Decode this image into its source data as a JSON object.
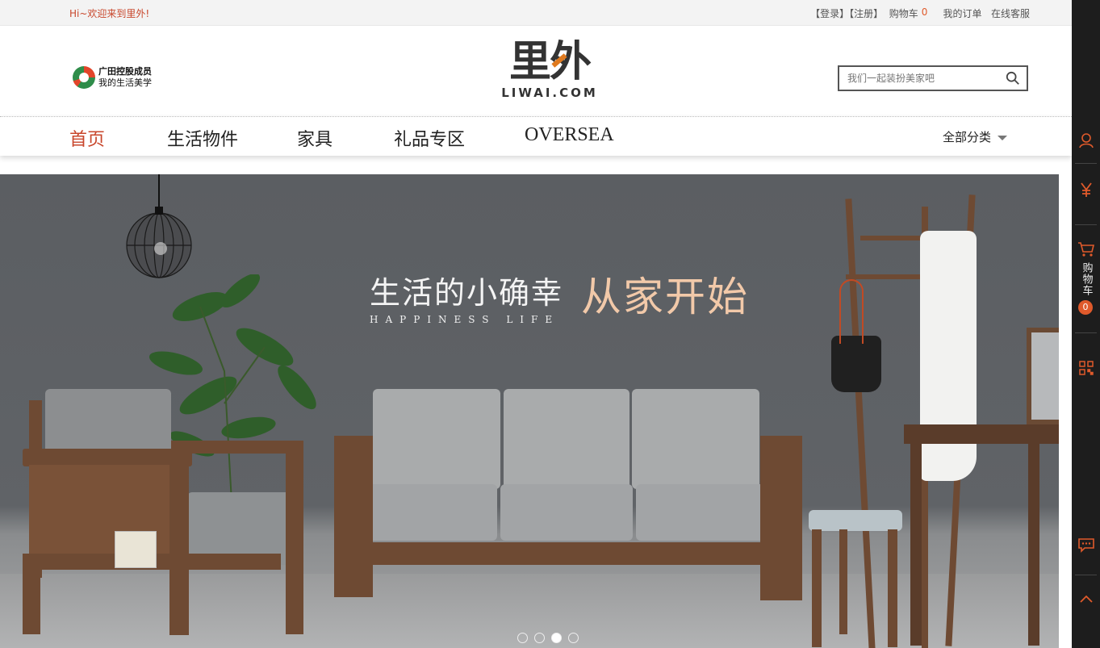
{
  "topbar": {
    "welcome": "Hi~欢迎来到里外!",
    "login": "登录",
    "register": "注册",
    "cart_label": "购物车",
    "cart_count": "0",
    "orders": "我的订单",
    "service": "在线客服"
  },
  "brand": {
    "line1": "广田控股成员",
    "line2": "我的生活美学"
  },
  "logo": {
    "cn": "里外",
    "en": "LIWAI.COM"
  },
  "search": {
    "placeholder": "我们一起装扮美家吧"
  },
  "nav": {
    "items": [
      {
        "label": "首页",
        "active": true
      },
      {
        "label": "生活物件"
      },
      {
        "label": "家具"
      },
      {
        "label": "礼品专区"
      },
      {
        "label": "OVERSEA"
      }
    ],
    "all_categories": "全部分类"
  },
  "banner": {
    "headline_cn": "生活的小确幸",
    "headline_en": "HAPPINESS  LIFE",
    "headline_accent": "从家开始",
    "slides_total": 4,
    "active_slide": 3
  },
  "sidebar": {
    "cart_text": "购物车",
    "cart_count": "0",
    "icons": [
      "user-icon",
      "yen-icon",
      "cart-icon",
      "qrcode-icon",
      "chat-icon",
      "back-to-top-icon"
    ]
  },
  "colors": {
    "accent": "#c8462b",
    "badge": "#e05a2b",
    "sidebar_bg": "#1d1d1d",
    "headline_accent": "#f2c9a9"
  }
}
